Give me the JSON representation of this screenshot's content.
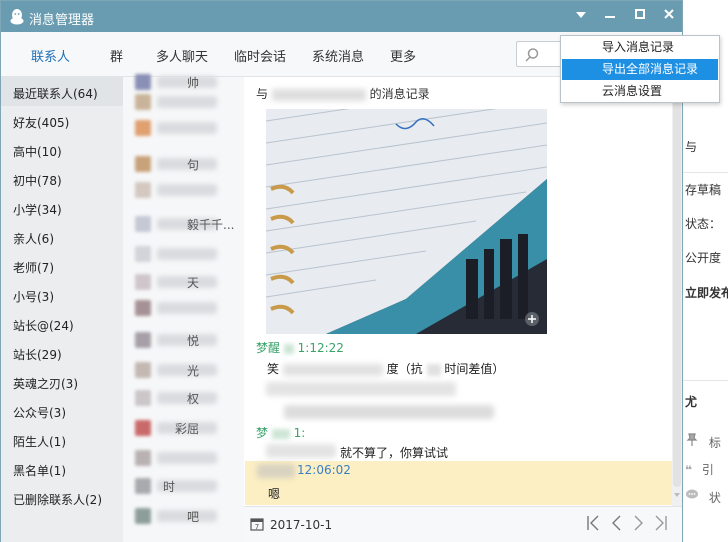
{
  "window": {
    "title": "消息管理器"
  },
  "nav": {
    "tabs": [
      "联系人",
      "群",
      "多人聊天",
      "临时会话",
      "系统消息",
      "更多"
    ]
  },
  "sidebar": {
    "categories": [
      "最近联系人(64)",
      "好友(405)",
      "高中(10)",
      "初中(78)",
      "小学(34)",
      "亲人(6)",
      "老师(7)",
      "小号(3)",
      "站长@(24)",
      "站长(29)",
      "英魂之刃(3)",
      "公众号(3)",
      "陌生人(1)",
      "黑名单(1)",
      "已删除联系人(2)"
    ]
  },
  "contacts": {
    "partial_text": [
      "帅",
      "",
      "",
      "句",
      "",
      "毅千千...",
      "",
      "天",
      "",
      "悦",
      "光",
      "权",
      "彩屈",
      "",
      "时",
      "吧"
    ]
  },
  "chat": {
    "record_title_prefix": "与",
    "record_title_suffix": "的消息记录",
    "msg1_sender": "梦醒",
    "msg1_time": "1:12:22",
    "msg1_text_a": "笑",
    "msg1_text_b": "度（抗",
    "msg1_text_c": "时间差值）",
    "msg2_sender_partial": "梦",
    "msg2_sender_partial2": "1:",
    "msg2_text": "就不算了，你算试试",
    "msg3_time": "12:06:02",
    "msg3_text": "嗯"
  },
  "footer": {
    "date": "2017-10-1"
  },
  "dropdown": {
    "items": [
      "导入消息记录",
      "导出全部消息记录",
      "云消息设置"
    ],
    "selected_index": 1
  },
  "background_app": {
    "lines": [
      "与",
      "存草稿",
      "状态：",
      "公开度",
      "立即发布",
      "尤",
      "标",
      "引",
      "状"
    ]
  },
  "colors": {
    "titlebar": "#6a9cb1",
    "accent": "#1f6fb8",
    "sender": "#3aa36a",
    "highlight": "#fbefc3",
    "menu_selected": "#1e90e3"
  }
}
